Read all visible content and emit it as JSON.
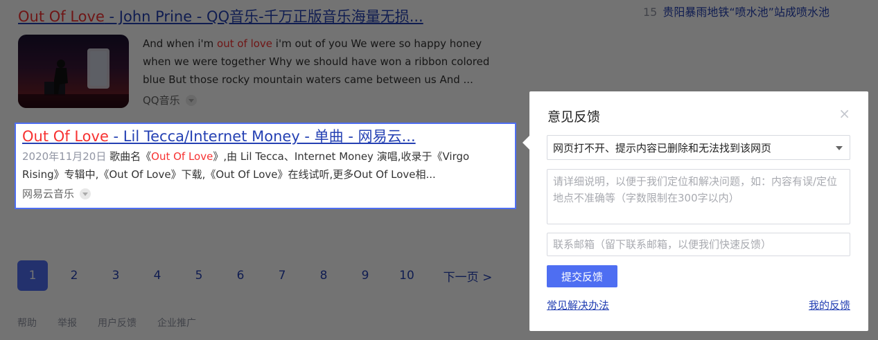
{
  "results": [
    {
      "title_highlight": "Out Of Love",
      "title_rest": " - John Prine - QQ音乐-千万正版音乐海量无损...",
      "snippet_pre": "And when i'm ",
      "snippet_highlight": "out of love",
      "snippet_post": " i'm out of you We were so happy honey when we were together Why we should have won a ribbon colored blue But those rocky mountain waters came between us And ...",
      "source": "QQ音乐"
    },
    {
      "title_highlight": "Out Of Love",
      "title_rest": " - Lil Tecca/Internet Money - 单曲 - 网易云...",
      "date": "2020年11月20日",
      "snippet_a": " 歌曲名《",
      "snippet_highlight": "Out Of Love",
      "snippet_b": "》,由 Lil Tecca、Internet Money 演唱,收录于《Virgo Rising》专辑中,《Out Of Love》下载,《Out Of Love》在线试听,更多Out Of Love相...",
      "source": "网易云音乐"
    }
  ],
  "hot_item": {
    "rank": "15",
    "text": "贵阳暴雨地铁“喷水池”站成喷水池"
  },
  "pagination": {
    "pages": [
      "1",
      "2",
      "3",
      "4",
      "5",
      "6",
      "7",
      "8",
      "9",
      "10"
    ],
    "active": "1",
    "next": "下一页 >"
  },
  "footer": [
    "帮助",
    "举报",
    "用户反馈",
    "企业推广"
  ],
  "feedback_dialog": {
    "title": "意见反馈",
    "close": "×",
    "selected_reason": "网页打不开、提示内容已删除和无法找到该网页",
    "detail_placeholder": "请详细说明，以便于我们定位和解决问题，如：内容有误/定位地点不准确等（字数限制在300字以内）",
    "email_placeholder": "联系邮箱（留下联系邮箱，以便我们快速反馈）",
    "submit": "提交反馈",
    "faq_link": "常见解决办法",
    "my_feedback_link": "我的反馈"
  },
  "colors": {
    "accent": "#4e6ef2",
    "link": "#2440b3",
    "highlight": "#f73131"
  }
}
